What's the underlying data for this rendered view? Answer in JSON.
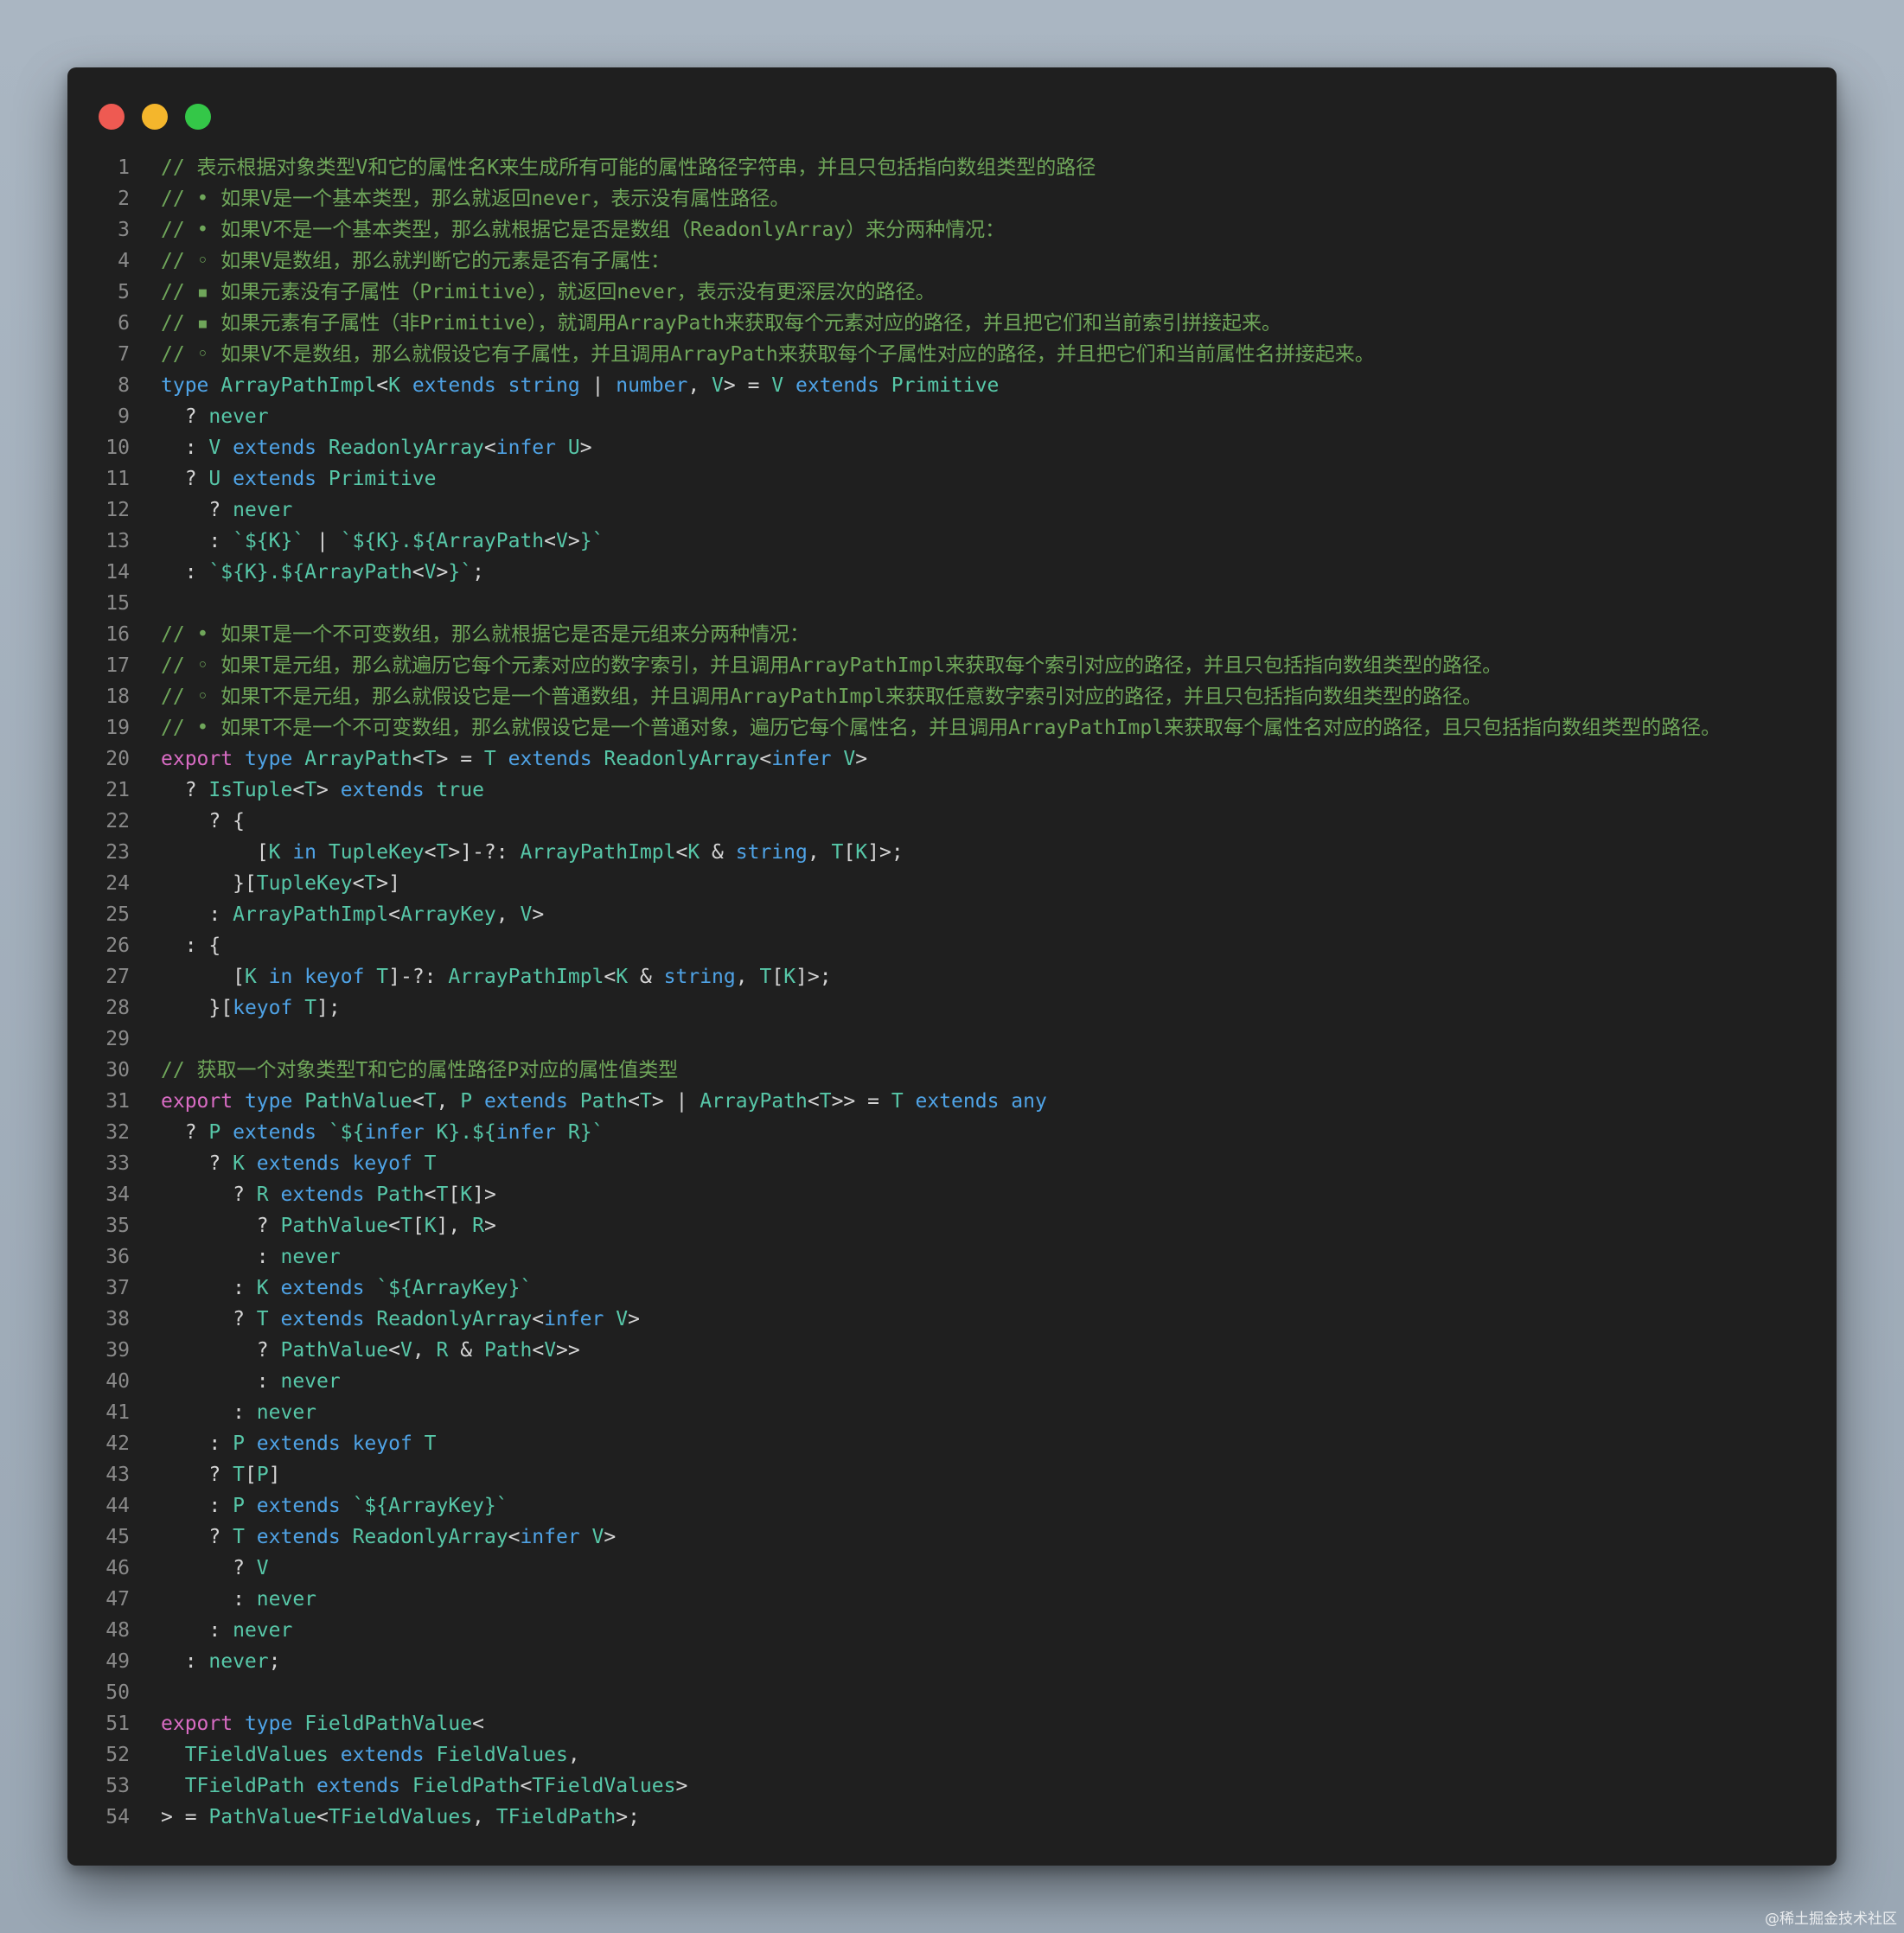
{
  "window": {
    "traffic_lights": [
      {
        "name": "close",
        "color": "#ee5a52"
      },
      {
        "name": "minimize",
        "color": "#f4b62c"
      },
      {
        "name": "maximize",
        "color": "#34c748"
      }
    ]
  },
  "colors": {
    "comment": "#6fa65a",
    "keyword": "#4fa3e6",
    "export": "#d96cc4",
    "type": "#57c7a8",
    "default": "#d4d4d4",
    "line_number": "#8a8a8a"
  },
  "code": [
    [
      [
        "c",
        "// 表示根据对象类型V和它的属性名K来生成所有可能的属性路径字符串，并且只包括指向数组类型的路径"
      ]
    ],
    [
      [
        "c",
        "// • 如果V是一个基本类型，那么就返回never，表示没有属性路径。"
      ]
    ],
    [
      [
        "c",
        "// • 如果V不是一个基本类型，那么就根据它是否是数组（ReadonlyArray）来分两种情况："
      ]
    ],
    [
      [
        "c",
        "// ◦ 如果V是数组，那么就判断它的元素是否有子属性："
      ]
    ],
    [
      [
        "c",
        "// ▪ 如果元素没有子属性（Primitive），就返回never，表示没有更深层次的路径。"
      ]
    ],
    [
      [
        "c",
        "// ▪ 如果元素有子属性（非Primitive），就调用ArrayPath来获取每个元素对应的路径，并且把它们和当前索引拼接起来。"
      ]
    ],
    [
      [
        "c",
        "// ◦ 如果V不是数组，那么就假设它有子属性，并且调用ArrayPath来获取每个子属性对应的路径，并且把它们和当前属性名拼接起来。"
      ]
    ],
    [
      [
        "k",
        "type "
      ],
      [
        "t",
        "ArrayPathImpl"
      ],
      [
        "d",
        "<"
      ],
      [
        "t",
        "K"
      ],
      [
        "k",
        " extends string"
      ],
      [
        "d",
        " | "
      ],
      [
        "k",
        "number"
      ],
      [
        "d",
        ", "
      ],
      [
        "t",
        "V"
      ],
      [
        "d",
        "> = "
      ],
      [
        "t",
        "V"
      ],
      [
        "k",
        " extends "
      ],
      [
        "t",
        "Primitive"
      ]
    ],
    [
      [
        "d",
        "  ? "
      ],
      [
        "t",
        "never"
      ]
    ],
    [
      [
        "d",
        "  : "
      ],
      [
        "t",
        "V"
      ],
      [
        "k",
        " extends "
      ],
      [
        "t",
        "ReadonlyArray"
      ],
      [
        "d",
        "<"
      ],
      [
        "k",
        "infer "
      ],
      [
        "t",
        "U"
      ],
      [
        "d",
        ">"
      ]
    ],
    [
      [
        "d",
        "  ? "
      ],
      [
        "t",
        "U"
      ],
      [
        "k",
        " extends "
      ],
      [
        "t",
        "Primitive"
      ]
    ],
    [
      [
        "d",
        "    ? "
      ],
      [
        "t",
        "never"
      ]
    ],
    [
      [
        "d",
        "    : "
      ],
      [
        "t",
        "`${K}`"
      ],
      [
        "d",
        " | "
      ],
      [
        "t",
        "`${K}.${"
      ],
      [
        "t",
        "ArrayPath"
      ],
      [
        "d",
        "<"
      ],
      [
        "t",
        "V"
      ],
      [
        "d",
        ">"
      ],
      [
        "t",
        "}`"
      ]
    ],
    [
      [
        "d",
        "  : "
      ],
      [
        "t",
        "`${K}.${"
      ],
      [
        "t",
        "ArrayPath"
      ],
      [
        "d",
        "<"
      ],
      [
        "t",
        "V"
      ],
      [
        "d",
        ">"
      ],
      [
        "t",
        "}`"
      ],
      [
        "d",
        ";"
      ]
    ],
    [],
    [
      [
        "c",
        "// • 如果T是一个不可变数组，那么就根据它是否是元组来分两种情况："
      ]
    ],
    [
      [
        "c",
        "// ◦ 如果T是元组，那么就遍历它每个元素对应的数字索引，并且调用ArrayPathImpl来获取每个索引对应的路径，并且只包括指向数组类型的路径。"
      ]
    ],
    [
      [
        "c",
        "// ◦ 如果T不是元组，那么就假设它是一个普通数组，并且调用ArrayPathImpl来获取任意数字索引对应的路径，并且只包括指向数组类型的路径。"
      ]
    ],
    [
      [
        "c",
        "// • 如果T不是一个不可变数组，那么就假设它是一个普通对象，遍历它每个属性名，并且调用ArrayPathImpl来获取每个属性名对应的路径，且只包括指向数组类型的路径。"
      ]
    ],
    [
      [
        "e",
        "export "
      ],
      [
        "k",
        "type "
      ],
      [
        "t",
        "ArrayPath"
      ],
      [
        "d",
        "<"
      ],
      [
        "t",
        "T"
      ],
      [
        "d",
        "> = "
      ],
      [
        "t",
        "T"
      ],
      [
        "k",
        " extends "
      ],
      [
        "t",
        "ReadonlyArray"
      ],
      [
        "d",
        "<"
      ],
      [
        "k",
        "infer "
      ],
      [
        "t",
        "V"
      ],
      [
        "d",
        ">"
      ]
    ],
    [
      [
        "d",
        "  ? "
      ],
      [
        "t",
        "IsTuple"
      ],
      [
        "d",
        "<"
      ],
      [
        "t",
        "T"
      ],
      [
        "d",
        ">"
      ],
      [
        "k",
        " extends "
      ],
      [
        "t",
        "true"
      ]
    ],
    [
      [
        "d",
        "    ? {"
      ]
    ],
    [
      [
        "d",
        "        ["
      ],
      [
        "t",
        "K"
      ],
      [
        "k",
        " in "
      ],
      [
        "t",
        "TupleKey"
      ],
      [
        "d",
        "<"
      ],
      [
        "t",
        "T"
      ],
      [
        "d",
        ">]-?: "
      ],
      [
        "t",
        "ArrayPathImpl"
      ],
      [
        "d",
        "<"
      ],
      [
        "t",
        "K"
      ],
      [
        "d",
        " & "
      ],
      [
        "k",
        "string"
      ],
      [
        "d",
        ", "
      ],
      [
        "t",
        "T"
      ],
      [
        "d",
        "["
      ],
      [
        "t",
        "K"
      ],
      [
        "d",
        "]>;"
      ]
    ],
    [
      [
        "d",
        "      }["
      ],
      [
        "t",
        "TupleKey"
      ],
      [
        "d",
        "<"
      ],
      [
        "t",
        "T"
      ],
      [
        "d",
        ">]"
      ]
    ],
    [
      [
        "d",
        "    : "
      ],
      [
        "t",
        "ArrayPathImpl"
      ],
      [
        "d",
        "<"
      ],
      [
        "t",
        "ArrayKey"
      ],
      [
        "d",
        ", "
      ],
      [
        "t",
        "V"
      ],
      [
        "d",
        ">"
      ]
    ],
    [
      [
        "d",
        "  : {"
      ]
    ],
    [
      [
        "d",
        "      ["
      ],
      [
        "t",
        "K"
      ],
      [
        "k",
        " in keyof "
      ],
      [
        "t",
        "T"
      ],
      [
        "d",
        "]-?: "
      ],
      [
        "t",
        "ArrayPathImpl"
      ],
      [
        "d",
        "<"
      ],
      [
        "t",
        "K"
      ],
      [
        "d",
        " & "
      ],
      [
        "k",
        "string"
      ],
      [
        "d",
        ", "
      ],
      [
        "t",
        "T"
      ],
      [
        "d",
        "["
      ],
      [
        "t",
        "K"
      ],
      [
        "d",
        "]>;"
      ]
    ],
    [
      [
        "d",
        "    }["
      ],
      [
        "k",
        "keyof "
      ],
      [
        "t",
        "T"
      ],
      [
        "d",
        "];"
      ]
    ],
    [],
    [
      [
        "c",
        "// 获取一个对象类型T和它的属性路径P对应的属性值类型"
      ]
    ],
    [
      [
        "e",
        "export "
      ],
      [
        "k",
        "type "
      ],
      [
        "t",
        "PathValue"
      ],
      [
        "d",
        "<"
      ],
      [
        "t",
        "T"
      ],
      [
        "d",
        ", "
      ],
      [
        "t",
        "P"
      ],
      [
        "k",
        " extends "
      ],
      [
        "t",
        "Path"
      ],
      [
        "d",
        "<"
      ],
      [
        "t",
        "T"
      ],
      [
        "d",
        "> | "
      ],
      [
        "t",
        "ArrayPath"
      ],
      [
        "d",
        "<"
      ],
      [
        "t",
        "T"
      ],
      [
        "d",
        ">> = "
      ],
      [
        "t",
        "T"
      ],
      [
        "k",
        " extends any"
      ]
    ],
    [
      [
        "d",
        "  ? "
      ],
      [
        "t",
        "P"
      ],
      [
        "k",
        " extends "
      ],
      [
        "t",
        "`${"
      ],
      [
        "k",
        "infer "
      ],
      [
        "t",
        "K}.${"
      ],
      [
        "k",
        "infer "
      ],
      [
        "t",
        "R}`"
      ]
    ],
    [
      [
        "d",
        "    ? "
      ],
      [
        "t",
        "K"
      ],
      [
        "k",
        " extends keyof "
      ],
      [
        "t",
        "T"
      ]
    ],
    [
      [
        "d",
        "      ? "
      ],
      [
        "t",
        "R"
      ],
      [
        "k",
        " extends "
      ],
      [
        "t",
        "Path"
      ],
      [
        "d",
        "<"
      ],
      [
        "t",
        "T"
      ],
      [
        "d",
        "["
      ],
      [
        "t",
        "K"
      ],
      [
        "d",
        "]>"
      ]
    ],
    [
      [
        "d",
        "        ? "
      ],
      [
        "t",
        "PathValue"
      ],
      [
        "d",
        "<"
      ],
      [
        "t",
        "T"
      ],
      [
        "d",
        "["
      ],
      [
        "t",
        "K"
      ],
      [
        "d",
        "], "
      ],
      [
        "t",
        "R"
      ],
      [
        "d",
        ">"
      ]
    ],
    [
      [
        "d",
        "        : "
      ],
      [
        "t",
        "never"
      ]
    ],
    [
      [
        "d",
        "      : "
      ],
      [
        "t",
        "K"
      ],
      [
        "k",
        " extends "
      ],
      [
        "t",
        "`${ArrayKey}`"
      ]
    ],
    [
      [
        "d",
        "      ? "
      ],
      [
        "t",
        "T"
      ],
      [
        "k",
        " extends "
      ],
      [
        "t",
        "ReadonlyArray"
      ],
      [
        "d",
        "<"
      ],
      [
        "k",
        "infer "
      ],
      [
        "t",
        "V"
      ],
      [
        "d",
        ">"
      ]
    ],
    [
      [
        "d",
        "        ? "
      ],
      [
        "t",
        "PathValue"
      ],
      [
        "d",
        "<"
      ],
      [
        "t",
        "V"
      ],
      [
        "d",
        ", "
      ],
      [
        "t",
        "R"
      ],
      [
        "d",
        " & "
      ],
      [
        "t",
        "Path"
      ],
      [
        "d",
        "<"
      ],
      [
        "t",
        "V"
      ],
      [
        "d",
        ">>"
      ]
    ],
    [
      [
        "d",
        "        : "
      ],
      [
        "t",
        "never"
      ]
    ],
    [
      [
        "d",
        "      : "
      ],
      [
        "t",
        "never"
      ]
    ],
    [
      [
        "d",
        "    : "
      ],
      [
        "t",
        "P"
      ],
      [
        "k",
        " extends keyof "
      ],
      [
        "t",
        "T"
      ]
    ],
    [
      [
        "d",
        "    ? "
      ],
      [
        "t",
        "T"
      ],
      [
        "d",
        "["
      ],
      [
        "t",
        "P"
      ],
      [
        "d",
        "]"
      ]
    ],
    [
      [
        "d",
        "    : "
      ],
      [
        "t",
        "P"
      ],
      [
        "k",
        " extends "
      ],
      [
        "t",
        "`${ArrayKey}`"
      ]
    ],
    [
      [
        "d",
        "    ? "
      ],
      [
        "t",
        "T"
      ],
      [
        "k",
        " extends "
      ],
      [
        "t",
        "ReadonlyArray"
      ],
      [
        "d",
        "<"
      ],
      [
        "k",
        "infer "
      ],
      [
        "t",
        "V"
      ],
      [
        "d",
        ">"
      ]
    ],
    [
      [
        "d",
        "      ? "
      ],
      [
        "t",
        "V"
      ]
    ],
    [
      [
        "d",
        "      : "
      ],
      [
        "t",
        "never"
      ]
    ],
    [
      [
        "d",
        "    : "
      ],
      [
        "t",
        "never"
      ]
    ],
    [
      [
        "d",
        "  : "
      ],
      [
        "t",
        "never"
      ],
      [
        "d",
        ";"
      ]
    ],
    [],
    [
      [
        "e",
        "export "
      ],
      [
        "k",
        "type "
      ],
      [
        "t",
        "FieldPathValue"
      ],
      [
        "d",
        "<"
      ]
    ],
    [
      [
        "d",
        "  "
      ],
      [
        "t",
        "TFieldValues"
      ],
      [
        "k",
        " extends "
      ],
      [
        "t",
        "FieldValues"
      ],
      [
        "d",
        ","
      ]
    ],
    [
      [
        "d",
        "  "
      ],
      [
        "t",
        "TFieldPath"
      ],
      [
        "k",
        " extends "
      ],
      [
        "t",
        "FieldPath"
      ],
      [
        "d",
        "<"
      ],
      [
        "t",
        "TFieldValues"
      ],
      [
        "d",
        ">"
      ]
    ],
    [
      [
        "d",
        "> = "
      ],
      [
        "t",
        "PathValue"
      ],
      [
        "d",
        "<"
      ],
      [
        "t",
        "TFieldValues"
      ],
      [
        "d",
        ", "
      ],
      [
        "t",
        "TFieldPath"
      ],
      [
        "d",
        ">;"
      ]
    ]
  ],
  "watermark": "@稀土掘金技术社区"
}
